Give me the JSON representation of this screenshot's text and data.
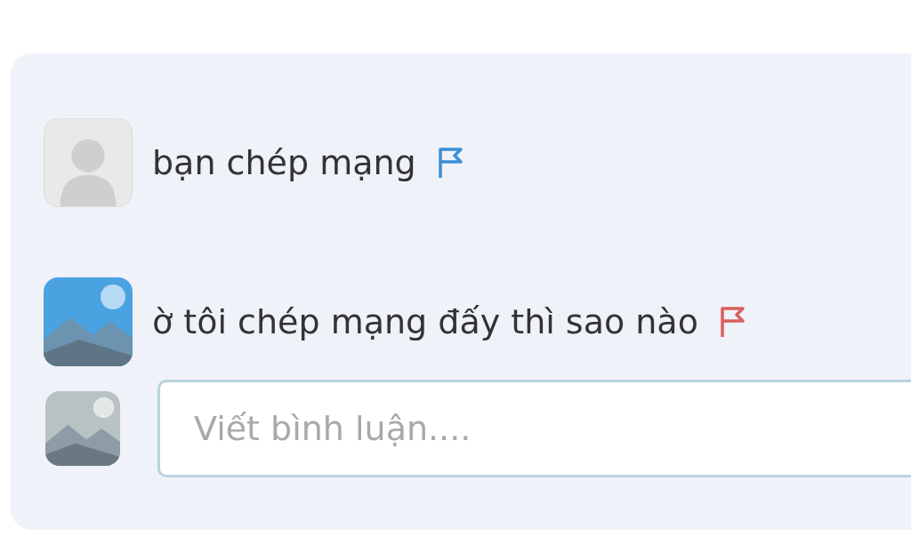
{
  "comments": [
    {
      "avatar": {
        "kind": "default"
      },
      "text": "bạn chép mạng",
      "color": "#3b8fd6"
    },
    {
      "text": "ờ tôi chép mạng đấy thì sao nào",
      "color": "#d9605c"
    }
  ],
  "composer": {
    "placeholder": "Viết bình luận...."
  }
}
